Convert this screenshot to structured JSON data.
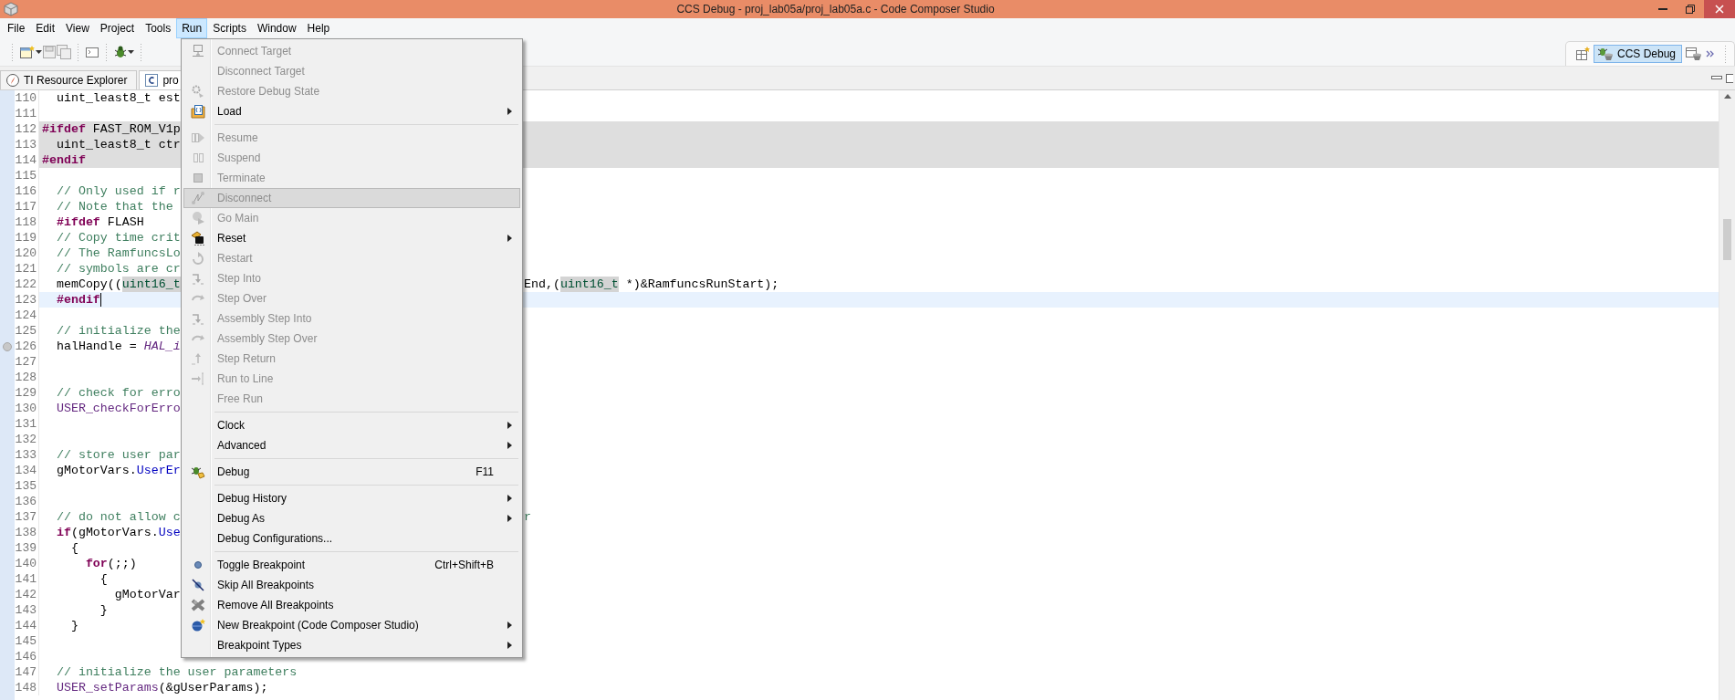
{
  "window": {
    "title": "CCS Debug - proj_lab05a/proj_lab05a.c - Code Composer Studio"
  },
  "menu_bar": [
    {
      "label": "File",
      "selected": false
    },
    {
      "label": "Edit",
      "selected": false
    },
    {
      "label": "View",
      "selected": false
    },
    {
      "label": "Project",
      "selected": false
    },
    {
      "label": "Tools",
      "selected": false
    },
    {
      "label": "Run",
      "selected": true
    },
    {
      "label": "Scripts",
      "selected": false
    },
    {
      "label": "Window",
      "selected": false
    },
    {
      "label": "Help",
      "selected": false
    }
  ],
  "perspectives": [
    {
      "label": "CCS Debug",
      "selected": true
    }
  ],
  "editor_tabs": [
    {
      "label": "TI Resource Explorer",
      "selected": false
    },
    {
      "label": "pro",
      "selected": true
    }
  ],
  "editor": {
    "lines": [
      {
        "number": "110",
        "left": [
          {
            "text": "  uint_least8_t est",
            "kind": "plain"
          }
        ]
      },
      {
        "number": "111"
      },
      {
        "number": "112",
        "shaded": true,
        "left": [
          {
            "text": "#ifdef",
            "kind": "keyword"
          },
          {
            "text": " FAST_ROM_V1p",
            "kind": "plain"
          }
        ]
      },
      {
        "number": "113",
        "shaded": true,
        "left": [
          {
            "text": "  uint_least8_t ctr",
            "kind": "plain"
          }
        ]
      },
      {
        "number": "114",
        "shaded": true,
        "left": [
          {
            "text": "#endif",
            "kind": "keyword"
          }
        ]
      },
      {
        "number": "115"
      },
      {
        "number": "116",
        "left": [
          {
            "text": "  // Only used if r",
            "kind": "comment"
          }
        ]
      },
      {
        "number": "117",
        "left": [
          {
            "text": "  // Note that the",
            "kind": "comment"
          }
        ]
      },
      {
        "number": "118",
        "left": [
          {
            "text": "  #ifdef",
            "kind": "keyword"
          },
          {
            "text": " FLASH",
            "kind": "plain"
          }
        ]
      },
      {
        "number": "119",
        "left": [
          {
            "text": "  // Copy time crit",
            "kind": "comment"
          }
        ]
      },
      {
        "number": "120",
        "left": [
          {
            "text": "  // The RamfuncsLo",
            "kind": "comment"
          }
        ]
      },
      {
        "number": "121",
        "left": [
          {
            "text": "  // symbols are cr",
            "kind": "comment"
          }
        ]
      },
      {
        "number": "122",
        "left": [
          {
            "text": "  memCopy((",
            "kind": "plain"
          },
          {
            "text": "uint16_t",
            "kind": "type-mark"
          }
        ],
        "right": [
          {
            "text": "End,(",
            "kind": "plain"
          },
          {
            "text": "uint16_t",
            "kind": "type-mark"
          },
          {
            "text": " *)&RamfuncsRunStart);",
            "kind": "plain"
          }
        ]
      },
      {
        "number": "123",
        "current": true,
        "cursor": true,
        "left": [
          {
            "text": "  #endif",
            "kind": "keyword"
          }
        ]
      },
      {
        "number": "124"
      },
      {
        "number": "125",
        "left": [
          {
            "text": "  // initialize the",
            "kind": "comment"
          }
        ]
      },
      {
        "number": "126",
        "marker": true,
        "left": [
          {
            "text": "  halHandle = ",
            "kind": "plain"
          },
          {
            "text": "HAL_i",
            "kind": "function"
          }
        ]
      },
      {
        "number": "127"
      },
      {
        "number": "128"
      },
      {
        "number": "129",
        "left": [
          {
            "text": "  // check for erro",
            "kind": "comment"
          }
        ]
      },
      {
        "number": "130",
        "left": [
          {
            "text": "  USER_checkForErro",
            "kind": "macro"
          }
        ]
      },
      {
        "number": "131"
      },
      {
        "number": "132"
      },
      {
        "number": "133",
        "left": [
          {
            "text": "  // store user par",
            "kind": "comment"
          }
        ]
      },
      {
        "number": "134",
        "left": [
          {
            "text": "  gMotorVars.",
            "kind": "plain"
          },
          {
            "text": "UserEr",
            "kind": "field"
          }
        ]
      },
      {
        "number": "135"
      },
      {
        "number": "136"
      },
      {
        "number": "137",
        "left": [
          {
            "text": "  // do not allow c",
            "kind": "comment"
          }
        ],
        "right": [
          {
            "text": "r",
            "kind": "comment"
          }
        ]
      },
      {
        "number": "138",
        "left": [
          {
            "text": "  if",
            "kind": "keyword"
          },
          {
            "text": "(gMotorVars.",
            "kind": "plain"
          },
          {
            "text": "Use",
            "kind": "field"
          }
        ]
      },
      {
        "number": "139",
        "left": [
          {
            "text": "    {",
            "kind": "plain"
          }
        ]
      },
      {
        "number": "140",
        "left": [
          {
            "text": "      for",
            "kind": "keyword"
          },
          {
            "text": "(;;)",
            "kind": "plain"
          }
        ]
      },
      {
        "number": "141",
        "left": [
          {
            "text": "        {",
            "kind": "plain"
          }
        ]
      },
      {
        "number": "142",
        "left": [
          {
            "text": "          gMotorVar",
            "kind": "plain"
          }
        ]
      },
      {
        "number": "143",
        "left": [
          {
            "text": "        }",
            "kind": "plain"
          }
        ]
      },
      {
        "number": "144",
        "left": [
          {
            "text": "    }",
            "kind": "plain"
          }
        ]
      },
      {
        "number": "145"
      },
      {
        "number": "146"
      },
      {
        "number": "147",
        "left": [
          {
            "text": "  // initialize the user parameters",
            "kind": "comment"
          }
        ]
      },
      {
        "number": "148",
        "left": [
          {
            "text": "  USER_setParams",
            "kind": "macro"
          },
          {
            "text": "(&gUserParams);",
            "kind": "plain"
          }
        ]
      }
    ]
  },
  "run_menu": {
    "items": [
      {
        "kind": "item",
        "label": "Connect Target",
        "disabled": true,
        "selected": false,
        "submenu": false
      },
      {
        "kind": "item",
        "label": "Disconnect Target",
        "disabled": true,
        "selected": false,
        "submenu": false
      },
      {
        "kind": "item",
        "label": "Restore Debug State",
        "disabled": true,
        "selected": false,
        "submenu": false
      },
      {
        "kind": "item",
        "label": "Load",
        "disabled": false,
        "selected": false,
        "submenu": true
      },
      {
        "kind": "separator"
      },
      {
        "kind": "item",
        "label": "Resume",
        "disabled": true,
        "selected": false,
        "submenu": false
      },
      {
        "kind": "item",
        "label": "Suspend",
        "disabled": true,
        "selected": false,
        "submenu": false
      },
      {
        "kind": "item",
        "label": "Terminate",
        "disabled": true,
        "selected": false,
        "submenu": false
      },
      {
        "kind": "item",
        "label": "Disconnect",
        "disabled": true,
        "selected": true,
        "submenu": false
      },
      {
        "kind": "item",
        "label": "Go Main",
        "disabled": true,
        "selected": false,
        "submenu": false
      },
      {
        "kind": "item",
        "label": "Reset",
        "disabled": false,
        "selected": false,
        "submenu": true
      },
      {
        "kind": "item",
        "label": "Restart",
        "disabled": true,
        "selected": false,
        "submenu": false
      },
      {
        "kind": "item",
        "label": "Step Into",
        "disabled": true,
        "selected": false,
        "submenu": false
      },
      {
        "kind": "item",
        "label": "Step Over",
        "disabled": true,
        "selected": false,
        "submenu": false
      },
      {
        "kind": "item",
        "label": "Assembly Step Into",
        "disabled": true,
        "selected": false,
        "submenu": false
      },
      {
        "kind": "item",
        "label": "Assembly Step Over",
        "disabled": true,
        "selected": false,
        "submenu": false
      },
      {
        "kind": "item",
        "label": "Step Return",
        "disabled": true,
        "selected": false,
        "submenu": false
      },
      {
        "kind": "item",
        "label": "Run to Line",
        "disabled": true,
        "selected": false,
        "submenu": false
      },
      {
        "kind": "item",
        "label": "Free Run",
        "disabled": true,
        "selected": false,
        "submenu": false
      },
      {
        "kind": "separator"
      },
      {
        "kind": "item",
        "label": "Clock",
        "disabled": false,
        "selected": false,
        "submenu": true
      },
      {
        "kind": "item",
        "label": "Advanced",
        "disabled": false,
        "selected": false,
        "submenu": true
      },
      {
        "kind": "separator"
      },
      {
        "kind": "item",
        "label": "Debug",
        "disabled": false,
        "selected": false,
        "submenu": false,
        "shortcut": "F11"
      },
      {
        "kind": "separator"
      },
      {
        "kind": "item",
        "label": "Debug History",
        "disabled": false,
        "selected": false,
        "submenu": true
      },
      {
        "kind": "item",
        "label": "Debug As",
        "disabled": false,
        "selected": false,
        "submenu": true
      },
      {
        "kind": "item",
        "label": "Debug Configurations...",
        "disabled": false,
        "selected": false,
        "submenu": false
      },
      {
        "kind": "separator"
      },
      {
        "kind": "item",
        "label": "Toggle Breakpoint",
        "disabled": false,
        "selected": false,
        "submenu": false,
        "shortcut": "Ctrl+Shift+B"
      },
      {
        "kind": "item",
        "label": "Skip All Breakpoints",
        "disabled": false,
        "selected": false,
        "submenu": false
      },
      {
        "kind": "item",
        "label": "Remove All Breakpoints",
        "disabled": false,
        "selected": false,
        "submenu": false
      },
      {
        "kind": "item",
        "label": "New Breakpoint (Code Composer Studio)",
        "disabled": false,
        "selected": false,
        "submenu": true
      },
      {
        "kind": "item",
        "label": "Breakpoint Types",
        "disabled": false,
        "selected": false,
        "submenu": true
      }
    ]
  }
}
